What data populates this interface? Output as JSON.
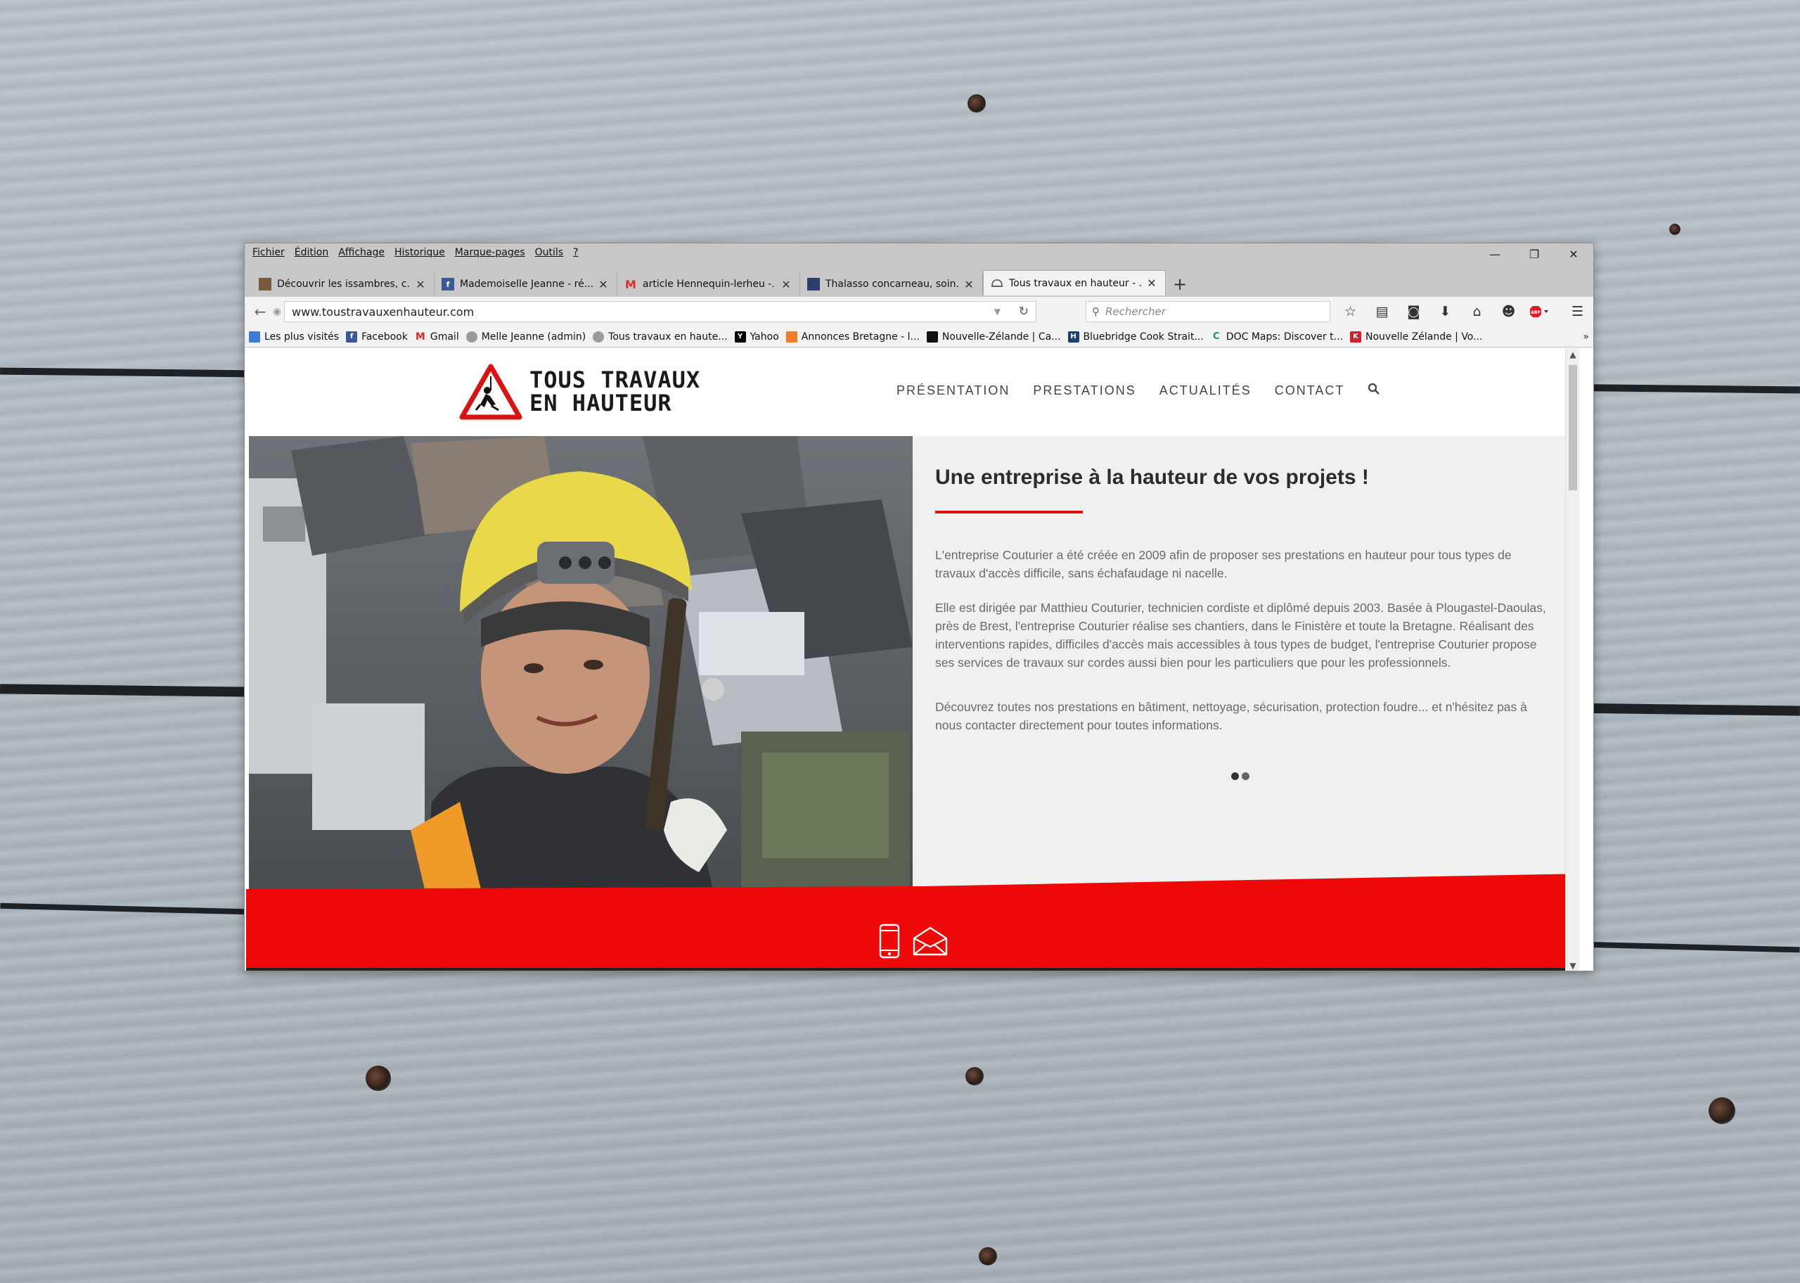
{
  "menubar": [
    "Fichier",
    "Édition",
    "Affichage",
    "Historique",
    "Marque-pages",
    "Outils",
    "?"
  ],
  "window_controls": {
    "minimize": "—",
    "restore": "❐",
    "close": "✕"
  },
  "tabs": [
    {
      "title": "Découvrir les issambres, c...",
      "icon": "page-icon",
      "color": "#7a5a3c"
    },
    {
      "title": "Mademoiselle Jeanne - ré...",
      "icon": "facebook-icon",
      "color": "#3b5998"
    },
    {
      "title": "article Hennequin-lerheu -...",
      "icon": "gmail-icon",
      "color": "#d93025"
    },
    {
      "title": "Thalasso concarneau, soin...",
      "icon": "page-icon",
      "color": "#2c3e6b"
    },
    {
      "title": "Tous travaux en hauteur - ...",
      "icon": "helmet-icon",
      "color": "#555555",
      "active": true
    }
  ],
  "newtab_label": "+",
  "url": "www.toustravauxenhauteur.com",
  "search_placeholder": "Rechercher",
  "bookmarks": [
    {
      "label": "Les plus visités",
      "icon": "mostvisited-icon",
      "color": "#3d7bd9"
    },
    {
      "label": "Facebook",
      "icon": "facebook-icon",
      "color": "#3b5998",
      "glyph": "f"
    },
    {
      "label": "Gmail",
      "icon": "gmail-icon",
      "color": "#d93025",
      "glyph": "M"
    },
    {
      "label": "Melle Jeanne (admin)",
      "icon": "globe-icon",
      "color": "#9a9a9a"
    },
    {
      "label": "Tous travaux en haute...",
      "icon": "globe-icon",
      "color": "#9a9a9a"
    },
    {
      "label": "Yahoo",
      "icon": "yahoo-icon",
      "color": "#000000",
      "glyph": "Y"
    },
    {
      "label": "Annonces Bretagne - l...",
      "icon": "annonces-icon",
      "color": "#f07c28"
    },
    {
      "label": "Nouvelle-Zélande | Ca...",
      "icon": "nz-icon",
      "color": "#111111"
    },
    {
      "label": "Bluebridge Cook Strait...",
      "icon": "bluebridge-icon",
      "color": "#1d3f7a",
      "glyph": "H"
    },
    {
      "label": "DOC Maps: Discover t...",
      "icon": "doc-icon",
      "color": "#2e8b57",
      "glyph": "C"
    },
    {
      "label": "Nouvelle Zélande | Vo...",
      "icon": "k-icon",
      "color": "#d61f2c",
      "glyph": "K"
    }
  ],
  "bookmarks_overflow": "»",
  "site": {
    "logo_line1": "TOUS TRAVAUX",
    "logo_line2": "EN HAUTEUR",
    "nav": [
      "PRÉSENTATION",
      "PRESTATIONS",
      "ACTUALITÉS",
      "CONTACT"
    ],
    "accent": "#d91212",
    "hero_title": "Une entreprise à la hauteur de vos projets !",
    "paragraphs": [
      "L'entreprise Couturier a été créée en 2009 afin de proposer ses prestations en hauteur pour tous types de travaux d'accès difficile, sans échafaudage ni nacelle.",
      "Elle est dirigée par Matthieu Couturier, technicien cordiste et diplômé depuis 2003. Basée à Plougastel-Daoulas, près de Brest, l'entreprise Couturier réalise ses chantiers, dans le Finistère et toute la Bretagne. Réalisant des interventions rapides, difficiles d'accès mais accessibles à tous types de budget, l'entreprise Couturier propose ses services de travaux sur cordes aussi bien pour les particuliers que pour les professionnels.",
      "Découvrez toutes nos prestations en bâtiment, nettoyage, sécurisation, protection foudre... et n'hésitez pas à nous contacter directement pour toutes informations."
    ],
    "slider_active_index": 0
  }
}
